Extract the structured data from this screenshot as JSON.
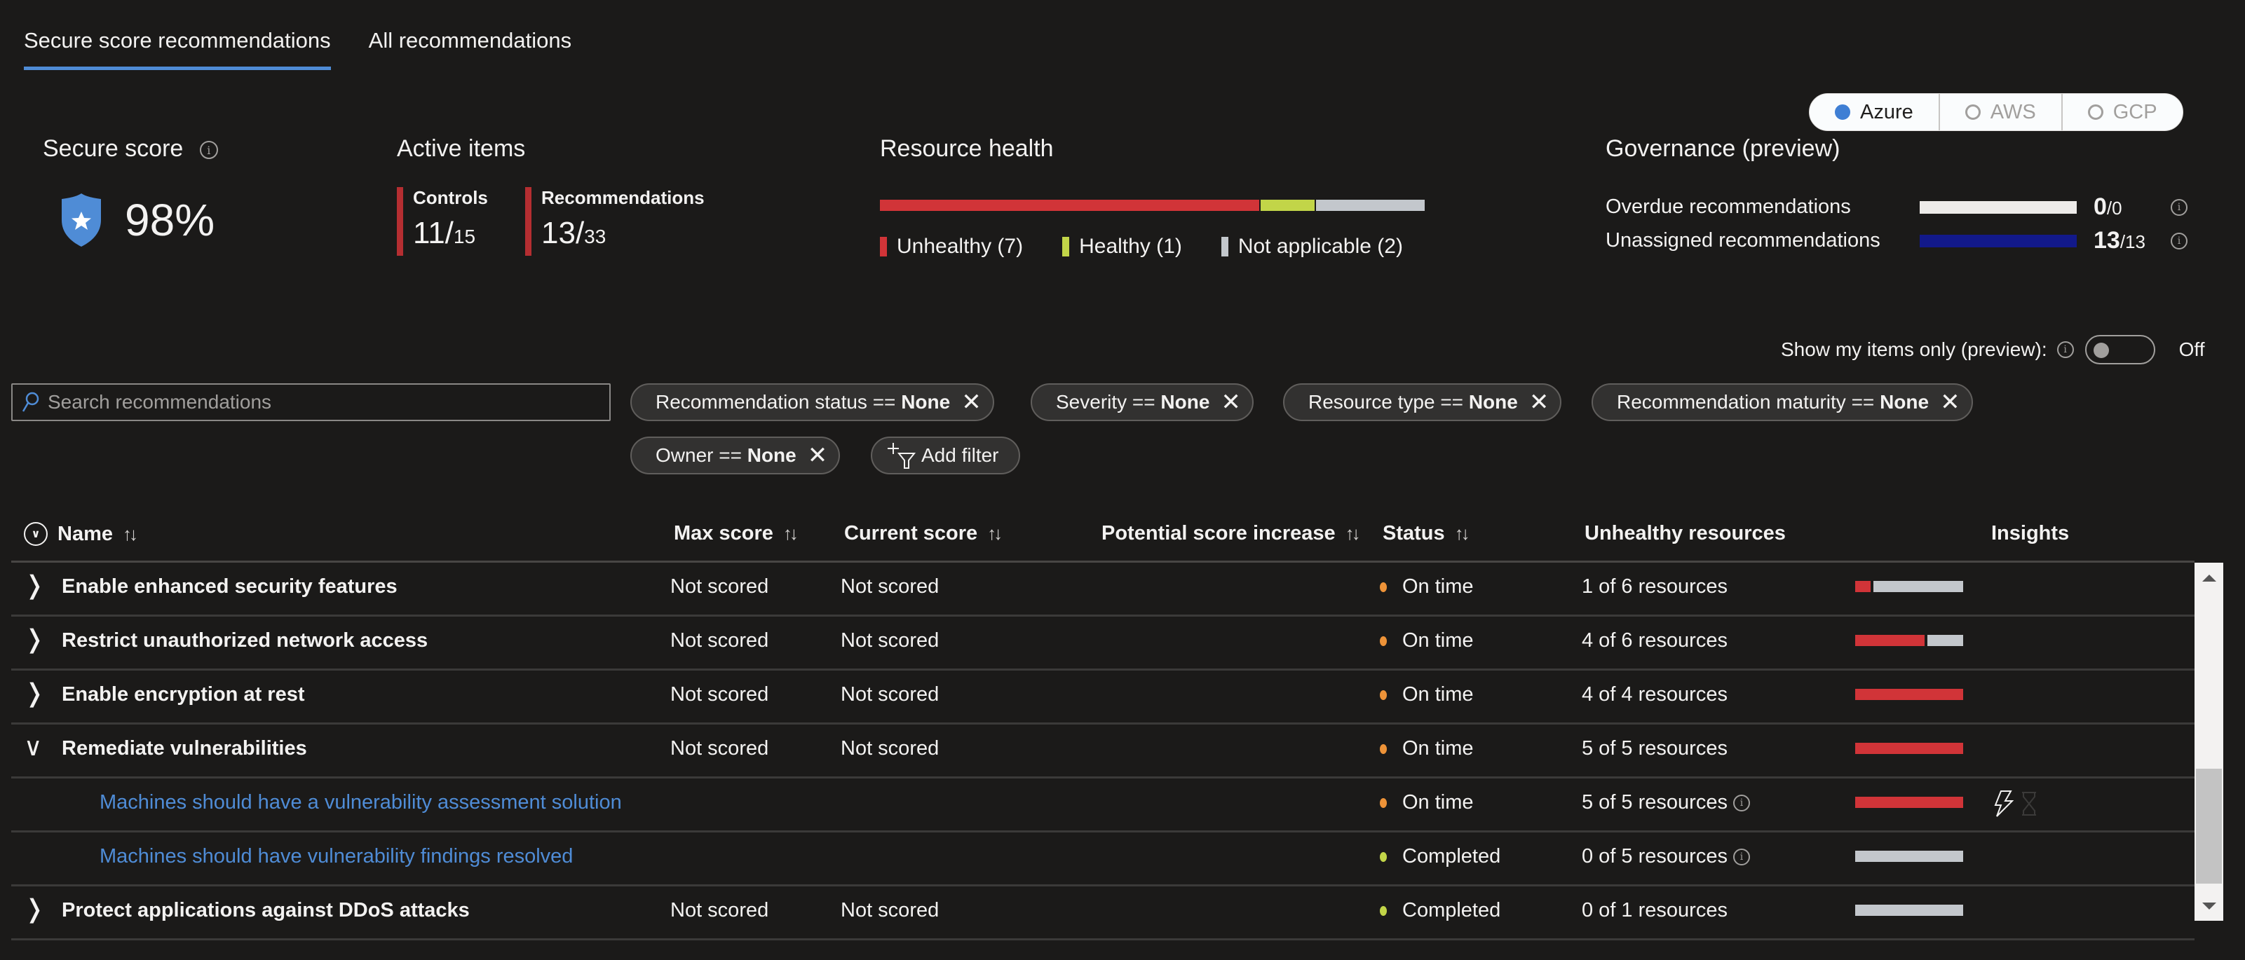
{
  "tabs": [
    {
      "label": "Secure score recommendations",
      "active": true
    },
    {
      "label": "All recommendations",
      "active": false
    }
  ],
  "cloud_toggle": [
    {
      "label": "Azure",
      "selected": true
    },
    {
      "label": "AWS",
      "selected": false
    },
    {
      "label": "GCP",
      "selected": false
    }
  ],
  "secure_score": {
    "title": "Secure score",
    "value": "98%",
    "icon": "shield-star-icon"
  },
  "active_items": {
    "title": "Active items",
    "controls": {
      "label": "Controls",
      "value": "11/",
      "total": "15"
    },
    "recommendations": {
      "label": "Recommendations",
      "value": "13/",
      "total": "33"
    }
  },
  "resource_health": {
    "title": "Resource health",
    "segments": [
      {
        "label": "Unhealthy (7)",
        "count": 7,
        "color": "#d13438"
      },
      {
        "label": "Healthy (1)",
        "count": 1,
        "color": "#c2d548"
      },
      {
        "label": "Not applicable (2)",
        "count": 2,
        "color": "#c3c7cc"
      }
    ]
  },
  "governance": {
    "title": "Governance (preview)",
    "rows": [
      {
        "label": "Overdue recommendations",
        "value": "0",
        "total": "/0",
        "color": "#edebe9"
      },
      {
        "label": "Unassigned recommendations",
        "value": "13",
        "total": "/13",
        "color": "#12198a"
      }
    ]
  },
  "my_items": {
    "label": "Show my items only (preview):",
    "state": "Off"
  },
  "search": {
    "placeholder": "Search recommendations",
    "value": ""
  },
  "filters": [
    {
      "key": "Recommendation status == ",
      "value": "None"
    },
    {
      "key": "Severity == ",
      "value": "None"
    },
    {
      "key": "Resource type == ",
      "value": "None"
    },
    {
      "key": "Recommendation maturity == ",
      "value": "None"
    },
    {
      "key": "Owner == ",
      "value": "None"
    }
  ],
  "add_filter_label": "Add filter",
  "table": {
    "columns": [
      "Name",
      "Max score",
      "Current score",
      "Potential score increase",
      "Status",
      "Unhealthy resources",
      "Insights"
    ],
    "rows": [
      {
        "name": "Enable enhanced security features",
        "type": "group",
        "expanded": false,
        "max": "Not scored",
        "current": "Not scored",
        "status": "On time",
        "status_color": "#ee9338",
        "unhealthy": "1 of 6 resources",
        "info": false,
        "bar": [
          1,
          5
        ]
      },
      {
        "name": "Restrict unauthorized network access",
        "type": "group",
        "expanded": false,
        "max": "Not scored",
        "current": "Not scored",
        "status": "On time",
        "status_color": "#ee9338",
        "unhealthy": "4 of 6 resources",
        "info": false,
        "bar": [
          4,
          2
        ]
      },
      {
        "name": "Enable encryption at rest",
        "type": "group",
        "expanded": false,
        "max": "Not scored",
        "current": "Not scored",
        "status": "On time",
        "status_color": "#ee9338",
        "unhealthy": "4 of 4 resources",
        "info": false,
        "bar": [
          4,
          0
        ]
      },
      {
        "name": "Remediate vulnerabilities",
        "type": "group",
        "expanded": true,
        "max": "Not scored",
        "current": "Not scored",
        "status": "On time",
        "status_color": "#ee9338",
        "unhealthy": "5 of 5 resources",
        "info": false,
        "bar": [
          5,
          0
        ]
      },
      {
        "name": "Machines should have a vulnerability assessment solution",
        "type": "child",
        "max": "",
        "current": "",
        "status": "On time",
        "status_color": "#ee9338",
        "unhealthy": "5 of 5 resources",
        "info": true,
        "bar": [
          5,
          0
        ],
        "insights": [
          "quick-fix-icon",
          "hourglass-icon"
        ]
      },
      {
        "name": "Machines should have vulnerability findings resolved",
        "type": "child",
        "max": "",
        "current": "",
        "status": "Completed",
        "status_color": "#c2d548",
        "unhealthy": "0 of 5 resources",
        "info": true,
        "bar": [
          0,
          5
        ]
      },
      {
        "name": "Protect applications against DDoS attacks",
        "type": "group",
        "expanded": false,
        "max": "Not scored",
        "current": "Not scored",
        "status": "Completed",
        "status_color": "#c2d548",
        "unhealthy": "0 of 1 resources",
        "info": false,
        "bar": [
          0,
          1
        ]
      }
    ]
  },
  "colors": {
    "accent": "#4f8cd6",
    "unhealthy": "#d13438",
    "healthy": "#c2d548",
    "not_applicable": "#c3c7cc",
    "on_time": "#ee9338"
  }
}
